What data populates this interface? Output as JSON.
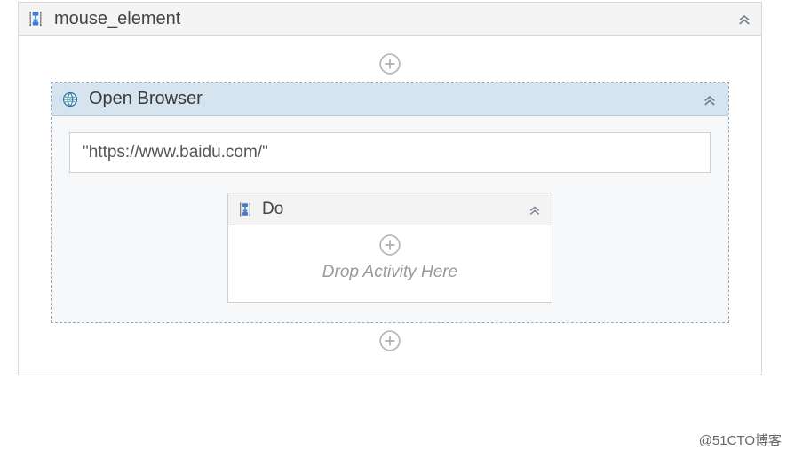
{
  "outerSequence": {
    "title": "mouse_element"
  },
  "openBrowser": {
    "title": "Open Browser",
    "url": "\"https://www.baidu.com/\""
  },
  "doBlock": {
    "title": "Do",
    "dropHint": "Drop Activity Here"
  },
  "watermark": "@51CTO博客"
}
